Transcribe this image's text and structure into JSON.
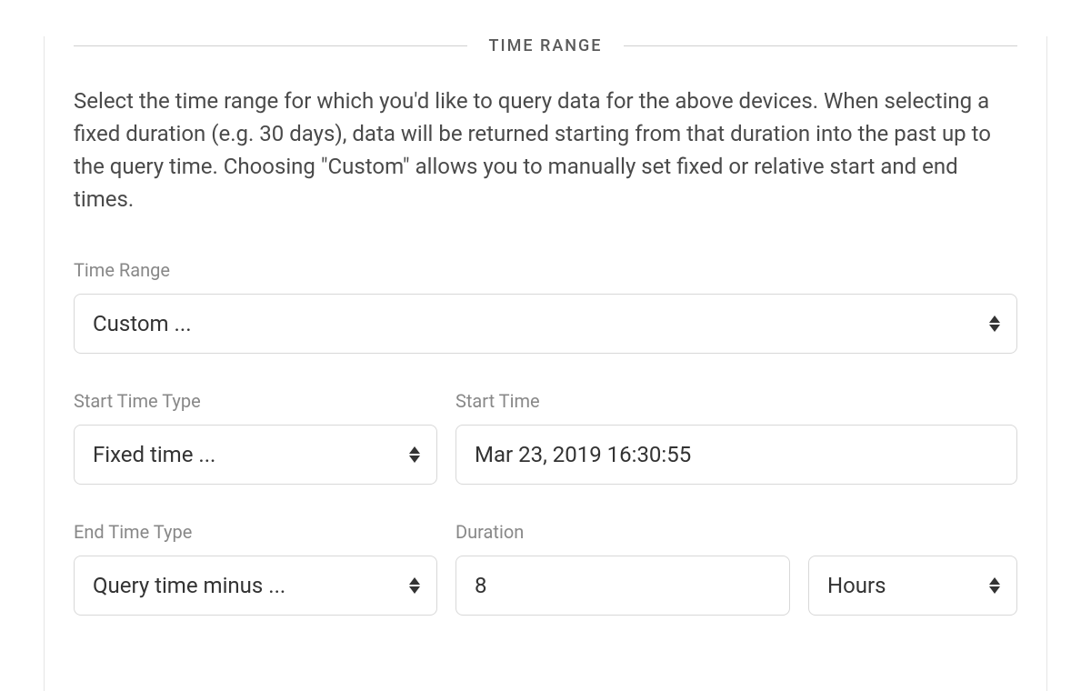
{
  "section": {
    "title": "TIME RANGE",
    "description": "Select the time range for which you'd like to query data for the above devices. When selecting a fixed duration (e.g. 30 days), data will be returned starting from that duration into the past up to the query time. Choosing \"Custom\" allows you to manually set fixed or relative start and end times."
  },
  "fields": {
    "time_range": {
      "label": "Time Range",
      "value": "Custom ..."
    },
    "start_time_type": {
      "label": "Start Time Type",
      "value": "Fixed time ..."
    },
    "start_time": {
      "label": "Start Time",
      "value": "Mar 23, 2019 16:30:55"
    },
    "end_time_type": {
      "label": "End Time Type",
      "value": "Query time minus ..."
    },
    "duration": {
      "label": "Duration",
      "value": "8",
      "unit": "Hours"
    }
  }
}
